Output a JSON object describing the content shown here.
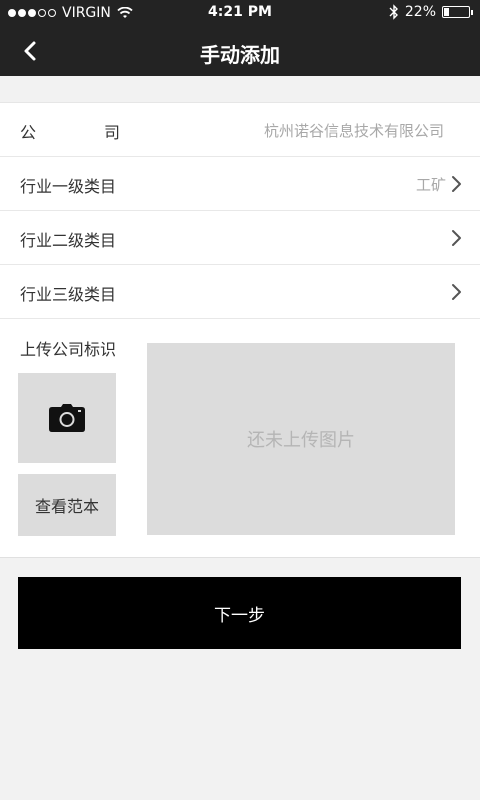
{
  "status_bar": {
    "carrier": "VIRGIN",
    "time": "4:21 PM",
    "battery_percent": "22%",
    "battery_level": 0.22,
    "signal_bars_filled": 3,
    "signal_bars_total": 5
  },
  "nav": {
    "back_icon": "chevron-left-icon",
    "title": "手动添加"
  },
  "form": {
    "company": {
      "label_left": "公",
      "label_right": "司",
      "value": "杭州诺谷信息技术有限公司"
    },
    "industry_1": {
      "label": "行业一级类目",
      "value": "工矿"
    },
    "industry_2": {
      "label": "行业二级类目",
      "value": ""
    },
    "industry_3": {
      "label": "行业三级类目",
      "value": ""
    },
    "upload": {
      "title": "上传公司标识",
      "camera_icon": "camera-icon",
      "sample_label": "查看范本",
      "placeholder": "还未上传图片"
    }
  },
  "next_button": {
    "label": "下一步"
  },
  "colors": {
    "header_bg": "#232323",
    "page_bg": "#f2f2f2",
    "button_bg": "#000000",
    "placeholder_bg": "#dcdcdc"
  }
}
